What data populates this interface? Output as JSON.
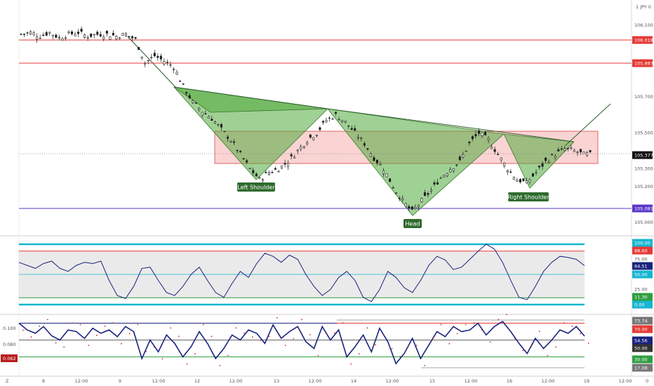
{
  "header": {
    "pair_label": "1 JPY 0"
  },
  "price_pane": {
    "y_ticks": [
      "106.100",
      "105.900",
      "105.700",
      "105.500",
      "105.300",
      "105.200",
      "105.000"
    ],
    "levels": [
      {
        "value": "106.018",
        "color": "#e53935"
      },
      {
        "value": "105.887",
        "color": "#e53935"
      },
      {
        "value": "105.377",
        "color": "#111111"
      },
      {
        "value": "105.081",
        "color": "#5c35c9"
      }
    ],
    "pattern_labels": {
      "left_shoulder": "Left Shoulder",
      "head": "Head",
      "right_shoulder": "Right Shoulder"
    }
  },
  "osc1_pane": {
    "y_ticks": [
      "75.00",
      "50.00",
      "25.00",
      "0.00"
    ],
    "badges": [
      {
        "value": "100.00",
        "color": "#16b5d1"
      },
      {
        "value": "88.60",
        "color": "#e53935"
      },
      {
        "value": "64.51",
        "color": "#1a237e"
      },
      {
        "value": "50.00",
        "color": "#16b5d1"
      },
      {
        "value": "11.30",
        "color": "#2e9e3f"
      },
      {
        "value": "0.00",
        "color": "#16b5d1"
      }
    ]
  },
  "osc2_pane": {
    "left_ticks": [
      "0.100",
      "0.080",
      "0.060"
    ],
    "left_badge": {
      "value": "0.062",
      "color": "#b71c1c"
    },
    "badges": [
      {
        "value": "73.74",
        "color": "#777777"
      },
      {
        "value": "70.00",
        "color": "#e53935"
      },
      {
        "value": "54.56",
        "color": "#1a237e"
      },
      {
        "value": "50.00",
        "color": "#333333"
      },
      {
        "value": "30.00",
        "color": "#2e9e3f"
      },
      {
        "value": "17.08",
        "color": "#777777"
      }
    ]
  },
  "x_axis": {
    "corner_label": "Z",
    "ticks": [
      "8",
      "12:00",
      "9",
      "12:00",
      "12",
      "12:00",
      "13",
      "12:00",
      "14",
      "12:00",
      "15",
      "12:00",
      "16",
      "12:00",
      "19",
      "12:00"
    ],
    "right_label": "0"
  },
  "chart_data": [
    {
      "type": "candlestick",
      "title": "",
      "ylim": [
        104.95,
        106.15
      ],
      "y_ticks": [
        106.1,
        105.9,
        105.7,
        105.5,
        105.3,
        105.2,
        105.0
      ],
      "x_ticks": [
        "8",
        "12:00",
        "9",
        "12:00",
        "12",
        "12:00",
        "13",
        "12:00",
        "14",
        "12:00",
        "15",
        "12:00",
        "16",
        "12:00",
        "19",
        "12:00"
      ],
      "close_series": [
        106.05,
        106.06,
        106.04,
        106.06,
        106.03,
        106.05,
        106.06,
        106.04,
        106.05,
        106.05,
        106.04,
        106.05,
        106.02,
        105.89,
        105.93,
        105.9,
        105.87,
        105.76,
        105.67,
        105.62,
        105.58,
        105.52,
        105.46,
        105.38,
        105.3,
        105.24,
        105.28,
        105.3,
        105.34,
        105.4,
        105.46,
        105.5,
        105.57,
        105.6,
        105.56,
        105.5,
        105.44,
        105.36,
        105.3,
        105.2,
        105.12,
        105.06,
        105.12,
        105.18,
        105.25,
        105.3,
        105.34,
        105.44,
        105.5,
        105.46,
        105.38,
        105.3,
        105.24,
        105.22,
        105.28,
        105.34,
        105.38,
        105.41,
        105.4,
        105.38
      ],
      "horizontal_levels": [
        106.018,
        105.887,
        105.377,
        105.081
      ],
      "last_price": 105.377,
      "annotations": [
        "Left Shoulder",
        "Head",
        "Right Shoulder"
      ],
      "pattern": "inverse head and shoulders"
    },
    {
      "type": "line",
      "ylim": [
        -5,
        105
      ],
      "y_ticks": [
        100,
        75,
        50,
        25,
        0
      ],
      "reference_lines": [
        100,
        88.6,
        50,
        11.3,
        0
      ],
      "series": [
        {
          "values": [
            70,
            65,
            60,
            68,
            72,
            60,
            55,
            65,
            70,
            68,
            72,
            40,
            15,
            10,
            30,
            60,
            62,
            40,
            20,
            15,
            30,
            50,
            62,
            40,
            20,
            12,
            35,
            55,
            45,
            68,
            85,
            80,
            70,
            82,
            75,
            50,
            30,
            15,
            25,
            45,
            55,
            40,
            12,
            5,
            25,
            55,
            45,
            28,
            20,
            40,
            65,
            80,
            74,
            58,
            62,
            75,
            88,
            100,
            92,
            70,
            40,
            12,
            8,
            30,
            55,
            70,
            80,
            78,
            75,
            64.51
          ]
        }
      ]
    },
    {
      "type": "line",
      "ylim": [
        12,
        78
      ],
      "left_axis_ticks": [
        0.1,
        0.08,
        0.06
      ],
      "reference_lines": [
        73.74,
        70,
        50,
        30,
        17.08
      ],
      "series": [
        {
          "values": [
            70,
            62,
            58,
            66,
            55,
            50,
            62,
            60,
            52,
            64,
            58,
            62,
            54,
            66,
            60,
            28,
            50,
            36,
            56,
            46,
            30,
            42,
            60,
            46,
            28,
            40,
            56,
            50,
            62,
            58,
            46,
            68,
            52,
            60,
            66,
            48,
            40,
            66,
            50,
            62,
            30,
            42,
            56,
            36,
            64,
            48,
            22,
            34,
            52,
            28,
            44,
            60,
            54,
            66,
            60,
            62,
            70,
            56,
            66,
            72,
            60,
            46,
            34,
            52,
            40,
            50,
            62,
            58,
            66,
            54.56
          ]
        }
      ]
    }
  ]
}
